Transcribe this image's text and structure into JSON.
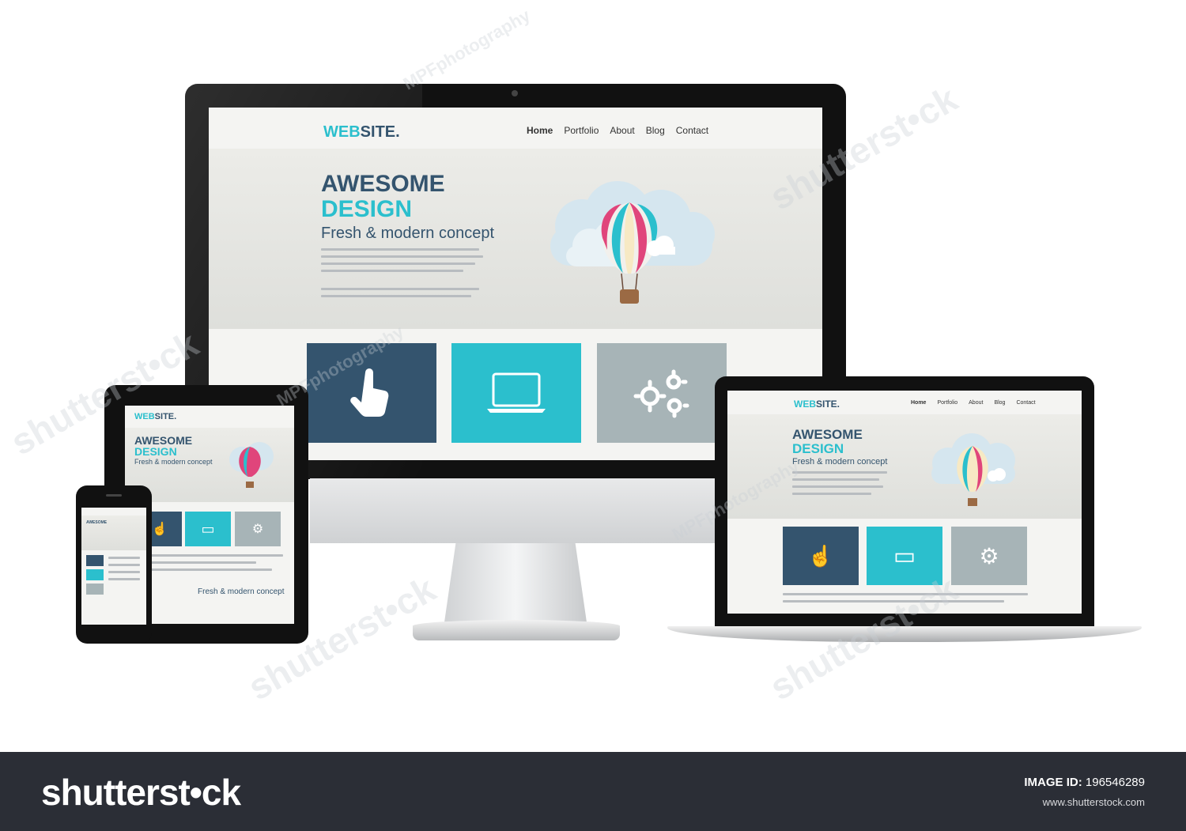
{
  "site": {
    "logo_a": "WEB",
    "logo_b": "SITE.",
    "nav": [
      "Home",
      "Portfolio",
      "About",
      "Blog",
      "Contact"
    ],
    "headline_1": "AWESOME",
    "headline_2": "DESIGN",
    "subheadline": "Fresh & modern concept"
  },
  "watermarks": {
    "mpf": "MPFphotography",
    "shutter": "shutterst•ck"
  },
  "footer": {
    "brand": "shutterst•ck",
    "image_id_label": "IMAGE ID:",
    "image_id": "196546289",
    "url": "www.shutterstock.com"
  },
  "colors": {
    "dark_tile": "#34546e",
    "cyan_tile": "#2bbfcd",
    "grey_tile": "#a7b4b7",
    "footer_bg": "#2b2e36"
  }
}
